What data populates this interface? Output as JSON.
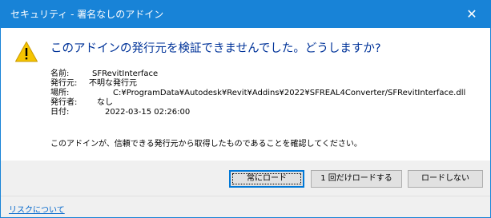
{
  "window": {
    "title": "セキュリティ - 署名なしのアドイン",
    "close_symbol": "✕"
  },
  "icons": {
    "warning": "warning-icon",
    "close": "close-icon"
  },
  "colors": {
    "titlebar": "#1883d7",
    "headline": "#003399",
    "warning_yellow": "#f5c400",
    "link": "#0066cc",
    "footer_bg": "#f0f0f0",
    "default_button_border": "#0078d7"
  },
  "main": {
    "headline": "このアドインの発行元を検証できませんでした。どうしますか?",
    "details": [
      {
        "label": "名前:",
        "value": "SFRevitInterface"
      },
      {
        "label": "発行元:",
        "value": "不明な発行元"
      },
      {
        "label": "場所:",
        "value": "C:¥ProgramData¥Autodesk¥Revit¥Addins¥2022¥SFREAL4Converter/SFRevitInterface.dll"
      },
      {
        "label": "発行者:",
        "value": "なし"
      },
      {
        "label": "日付:",
        "value": "2022-03-15 02:26:00"
      }
    ],
    "note": "このアドインが、信頼できる発行元から取得したものであることを確認してください。"
  },
  "buttons": {
    "always_load": "常にロード",
    "load_once": "1 回だけロードする",
    "do_not_load": "ロードしない"
  },
  "footer": {
    "risk_link": "リスクについて"
  }
}
